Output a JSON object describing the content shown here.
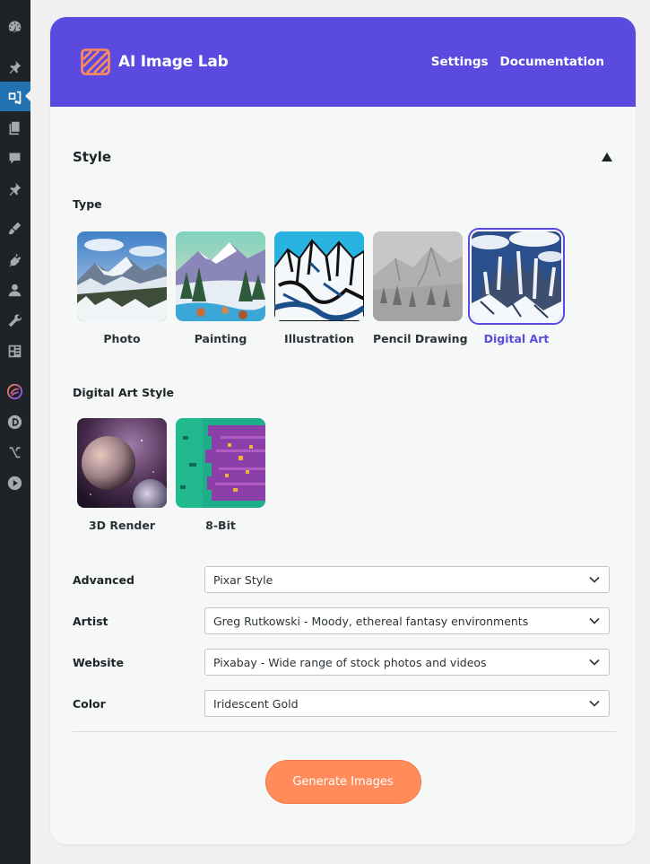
{
  "header": {
    "brand": "AI Image Lab",
    "links": [
      "Settings",
      "Documentation"
    ]
  },
  "style_section": {
    "title": "Style",
    "type_label": "Type",
    "types": [
      {
        "label": "Photo",
        "selected": false
      },
      {
        "label": "Painting",
        "selected": false
      },
      {
        "label": "Illustration",
        "selected": false
      },
      {
        "label": "Pencil Drawing",
        "selected": false
      },
      {
        "label": "Digital Art",
        "selected": true
      }
    ],
    "sub_label": "Digital Art Style",
    "sub_styles": [
      {
        "label": "3D Render"
      },
      {
        "label": "8-Bit"
      }
    ]
  },
  "fields": [
    {
      "label": "Advanced",
      "value": "Pixar Style"
    },
    {
      "label": "Artist",
      "value": "Greg Rutkowski - Moody, ethereal fantasy environments"
    },
    {
      "label": "Website",
      "value": "Pixabay - Wide range of stock photos and videos"
    },
    {
      "label": "Color",
      "value": "Iridescent Gold"
    }
  ],
  "generate_button": "Generate Images",
  "colors": {
    "accent": "#5b4ae0",
    "button": "#ff8c5a",
    "sidebar": "#1d2327",
    "sidebar_active": "#2271b1"
  },
  "sidebar_icons": [
    "dashboard-icon",
    "pin-icon",
    "media-icon",
    "pages-icon",
    "comments-icon",
    "pin-icon",
    "appearance-icon",
    "plugins-icon",
    "users-icon",
    "tools-icon",
    "settings-icon",
    "plugin-swirl-icon",
    "plugin-d-icon",
    "plugin-arrows-icon",
    "play-icon"
  ]
}
